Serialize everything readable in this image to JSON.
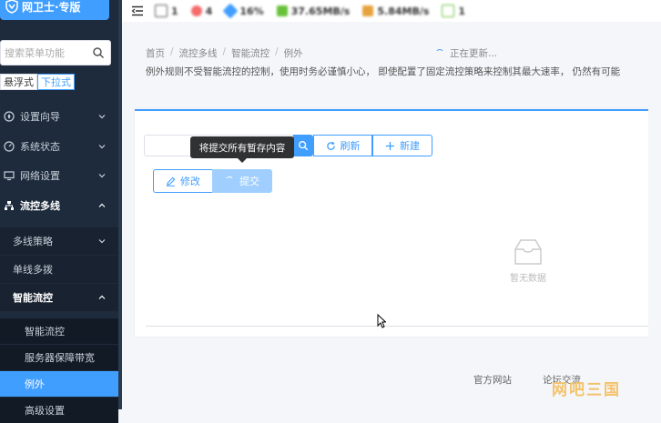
{
  "app": {
    "title": "网卫士·专版"
  },
  "sidebar": {
    "search_placeholder": "搜索菜单功能",
    "modes": [
      "悬浮式",
      "下拉式"
    ],
    "menu": [
      {
        "label": "设置向导"
      },
      {
        "label": "系统状态"
      },
      {
        "label": "网络设置"
      },
      {
        "label": "流控多线"
      }
    ],
    "submenu": [
      {
        "label": "多线策略"
      },
      {
        "label": "单线多拨"
      },
      {
        "label": "智能流控"
      }
    ],
    "sub2": [
      {
        "label": "智能流控"
      },
      {
        "label": "服务器保障带宽"
      },
      {
        "label": "例外"
      },
      {
        "label": "高级设置"
      }
    ]
  },
  "topbar": {
    "stats": [
      "1",
      "4",
      "16%",
      "37.65MB/s",
      "5.84MB/s",
      "1"
    ]
  },
  "breadcrumb": [
    "首页",
    "流控多线",
    "智能流控",
    "例外"
  ],
  "status_text": "正在更新...",
  "description": "例外规则不受智能流控的控制，使用时务必谨慎小心， 即使配置了固定流控策略来控制其最大速率， 仍然有可能",
  "toolbar": {
    "refresh_label": "刷新",
    "new_label": "新建",
    "edit_label": "修改",
    "submit_label": "提交",
    "tooltip": "将提交所有暂存内容"
  },
  "table": {
    "empty_text": "暂无数据"
  },
  "footer": {
    "links": [
      "官方网站",
      "论坛交流"
    ]
  },
  "watermark": "网吧三国",
  "colors": {
    "accent": "#409eff",
    "sidebar_bg": "#1e2b3c"
  }
}
